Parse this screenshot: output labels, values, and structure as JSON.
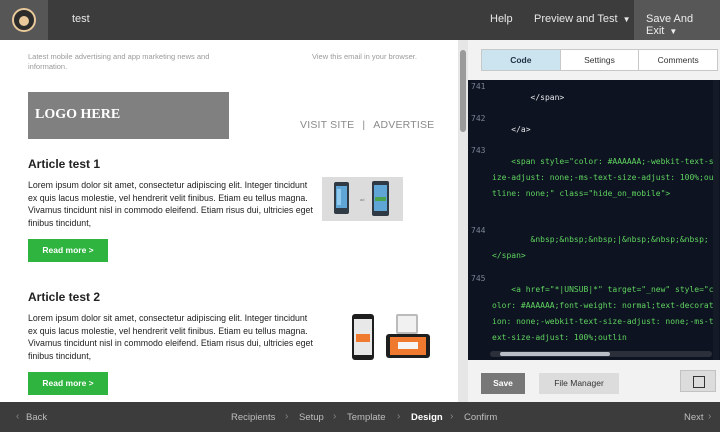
{
  "topbar": {
    "title": "test",
    "help": "Help",
    "preview": "Preview and Test",
    "exit": "Save And Exit"
  },
  "email": {
    "preheader": "Latest mobile advertising and app marketing news and information.",
    "view_in_browser": "View this email in your browser.",
    "logo_text": "LOGO HERE",
    "links": [
      "VISIT SITE",
      "|",
      "ADVERTISE"
    ],
    "articles": [
      {
        "title": "Article test 1",
        "body": "Lorem ipsum dolor sit amet, consectetur adipiscing elit. Integer tincidunt ex quis lacus molestie, vel hendrerit velit finibus. Etiam eu tellus magna. Vivamus tincidunt nisl in commodo eleifend. Etiam risus dui, ultricies eget finibus tincidunt,",
        "button": "Read more >"
      },
      {
        "title": "Article test 2",
        "body": "Lorem ipsum dolor sit amet, consectetur adipiscing elit. Integer tincidunt ex quis lacus molestie, vel hendrerit velit finibus. Etiam eu tellus magna. Vivamus tincidunt nisl in commodo eleifend. Etiam risus dui, ultricies eget finibus tincidunt,",
        "button": "Read more >"
      }
    ]
  },
  "panel": {
    "tabs": [
      "Code",
      "Settings",
      "Comments"
    ],
    "active_tab": "Code",
    "code_lines": [
      {
        "num": "741",
        "text": "        </span>"
      },
      {
        "num": "742",
        "text": "    </a>"
      },
      {
        "num": "743",
        "text": "    <span style=\"color: #AAAAAA;-webkit-text-size-adjust: none;-ms-text-size-adjust: 100%;outline: none;\" class=\"hide_on_mobile\">"
      },
      {
        "num": "744",
        "text": "        &nbsp;&nbsp;&nbsp;|&nbsp;&nbsp;&nbsp;</span>"
      },
      {
        "num": "745",
        "text": "    <a href=\"*|UNSUB|*\" target=\"_new\" style=\"color: #AAAAAA;font-weight: normal;text-decoration: none;-webkit-text-size-adjust: none;-ms-text-size-adjust: 100%;outlin"
      }
    ],
    "save": "Save",
    "file_manager": "File Manager"
  },
  "steps": {
    "back": "Back",
    "items": [
      "Recipients",
      "Setup",
      "Template",
      "Design",
      "Confirm"
    ],
    "active": "Design",
    "next": "Next"
  },
  "colors": {
    "topbar": "#3c3c3c",
    "accent_green": "#2fb43f",
    "code_bg": "#0d1320",
    "code_string": "#5fd35f",
    "active_tab": "#cce3f0"
  }
}
